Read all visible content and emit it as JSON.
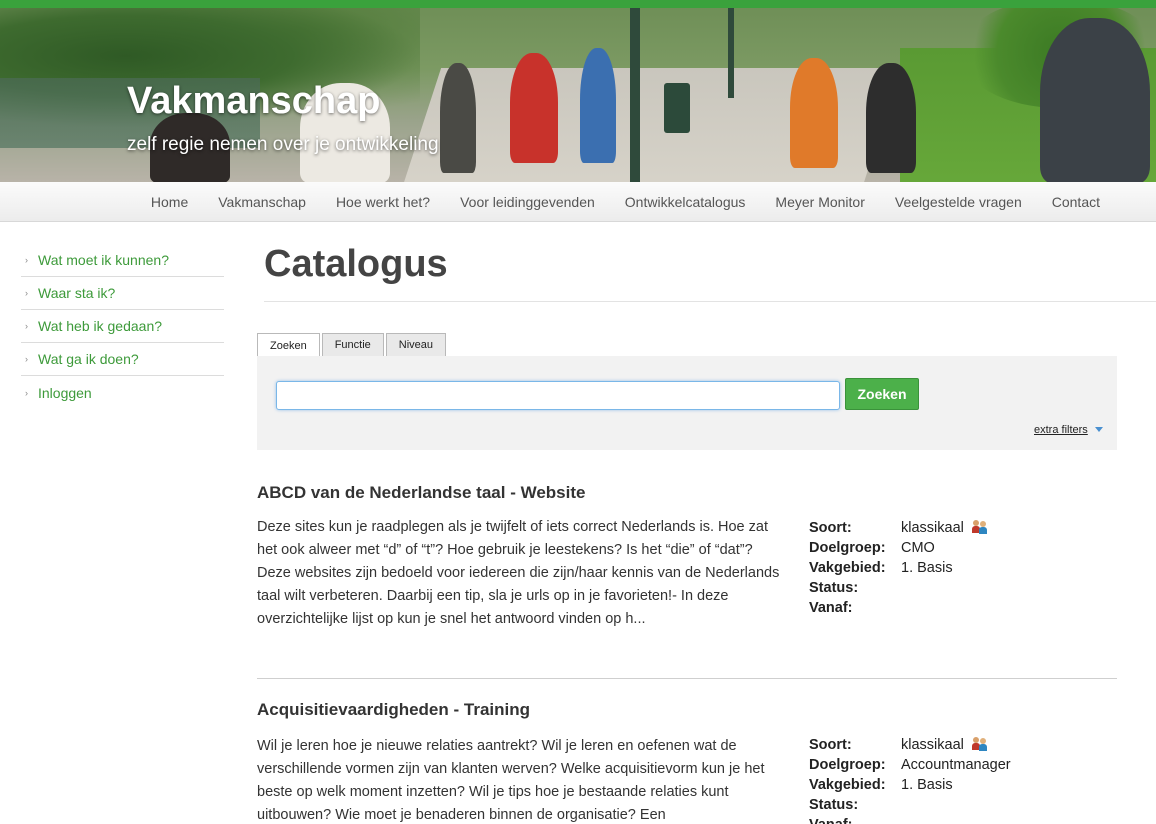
{
  "site": {
    "title": "Vakmanschap",
    "tagline": "zelf regie nemen over je ontwikkeling"
  },
  "nav": {
    "items": [
      "Home",
      "Vakmanschap",
      "Hoe werkt het?",
      "Voor leidinggevenden",
      "Ontwikkelcatalogus",
      "Meyer Monitor",
      "Veelgestelde vragen",
      "Contact"
    ]
  },
  "sidebar": {
    "items": [
      {
        "label": "Wat moet ik kunnen?"
      },
      {
        "label": "Waar sta ik?"
      },
      {
        "label": "Wat heb ik gedaan?"
      },
      {
        "label": "Wat ga ik doen?"
      },
      {
        "label": "Inloggen"
      }
    ]
  },
  "main": {
    "title": "Catalogus",
    "tabs": [
      "Zoeken",
      "Functie",
      "Niveau"
    ],
    "search": {
      "value": "",
      "placeholder": "",
      "button": "Zoeken",
      "extra_filters": "extra filters"
    },
    "results": [
      {
        "title": "ABCD van de Nederlandse taal - Website",
        "description": "Deze sites kun je raadplegen als je twijfelt of iets correct Nederlands is. Hoe zat het ook alweer met “d” of “t”? Hoe gebruik je leestekens? Is het “die” of “dat”? Deze websites zijn bedoeld voor iedereen die zijn/haar kennis van de Nederlands taal wilt verbeteren. Daarbij een tip, sla je urls op in je favorieten!- In deze overzichtelijke lijst op  kun je snel het antwoord vinden op h...",
        "meta": {
          "soort_label": "Soort:",
          "soort": "klassikaal",
          "doelgroep_label": "Doelgroep:",
          "doelgroep": "CMO",
          "vakgebied_label": "Vakgebied:",
          "vakgebied": "1. Basis",
          "status_label": "Status:",
          "status": "",
          "vanaf_label": "Vanaf:",
          "vanaf": ""
        }
      },
      {
        "title": "Acquisitievaardigheden - Training",
        "description": "Wil je leren hoe je nieuwe relaties aantrekt? Wil je leren en oefenen wat de verschillende vormen zijn van klanten werven? Welke acquisitievorm kun je het beste op welk moment inzetten? Wil je tips hoe je bestaande relaties kunt uitbouwen? Wie moet je benaderen binnen de organisatie? Een",
        "meta": {
          "soort_label": "Soort:",
          "soort": "klassikaal",
          "doelgroep_label": "Doelgroep:",
          "doelgroep": "Accountmanager",
          "vakgebied_label": "Vakgebied:",
          "vakgebied": "1. Basis",
          "status_label": "Status:",
          "status": "",
          "vanaf_label": "Vanaf:",
          "vanaf": ""
        }
      }
    ]
  },
  "colors": {
    "brand_green": "#3aa23c",
    "link_green": "#3d9a3a",
    "button_green": "#4cb04a"
  }
}
